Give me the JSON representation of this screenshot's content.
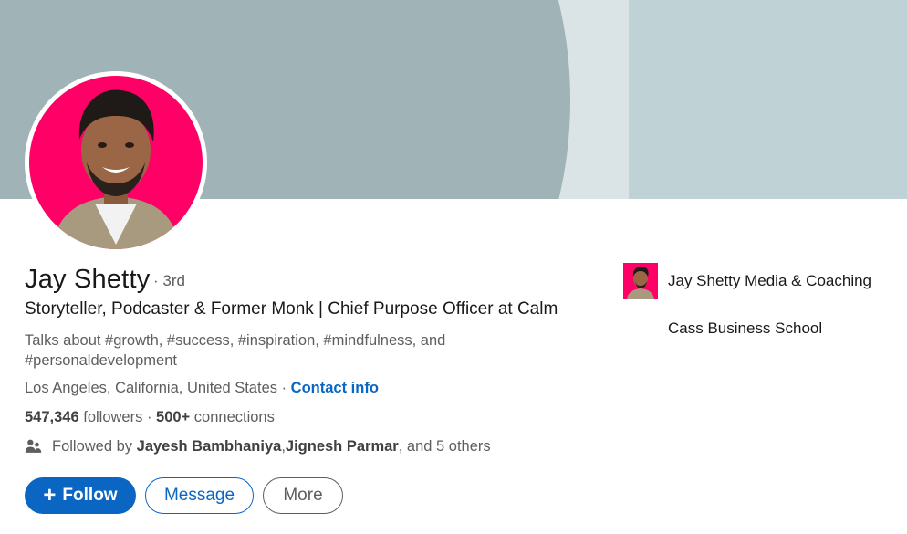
{
  "profile": {
    "name": "Jay Shetty",
    "degree": "· 3rd",
    "headline": "Storyteller, Podcaster & Former Monk | Chief Purpose Officer at Calm",
    "talks_about": "Talks about #growth, #success, #inspiration, #mindfulness, and #personaldevelopment",
    "location": "Los Angeles, California, United States",
    "location_sep": " · ",
    "contact_info": "Contact info",
    "followers_count": "547,346",
    "followers_label": " followers",
    "connections_sep": " · ",
    "connections_count": "500+",
    "connections_label": " connections",
    "followed_prefix": "Followed by ",
    "followed_person1": "Jayesh Bambhaniya",
    "followed_comma": ", ",
    "followed_person2": "Jignesh Parmar",
    "followed_suffix": ", and 5 others"
  },
  "actions": {
    "follow_plus": "+",
    "follow": "Follow",
    "message": "Message",
    "more": "More"
  },
  "organizations": [
    {
      "name": "Jay Shetty Media & Coaching"
    },
    {
      "name": "Cass Business School"
    }
  ],
  "colors": {
    "accent": "#0a66c2",
    "avatar_bg": "#ff0066",
    "banner_light": "#dae4e6",
    "banner_dark": "#a0b3b7",
    "banner_panel": "#bfd3d6"
  },
  "icons": {
    "followers": "people-icon",
    "follow": "plus-icon"
  }
}
